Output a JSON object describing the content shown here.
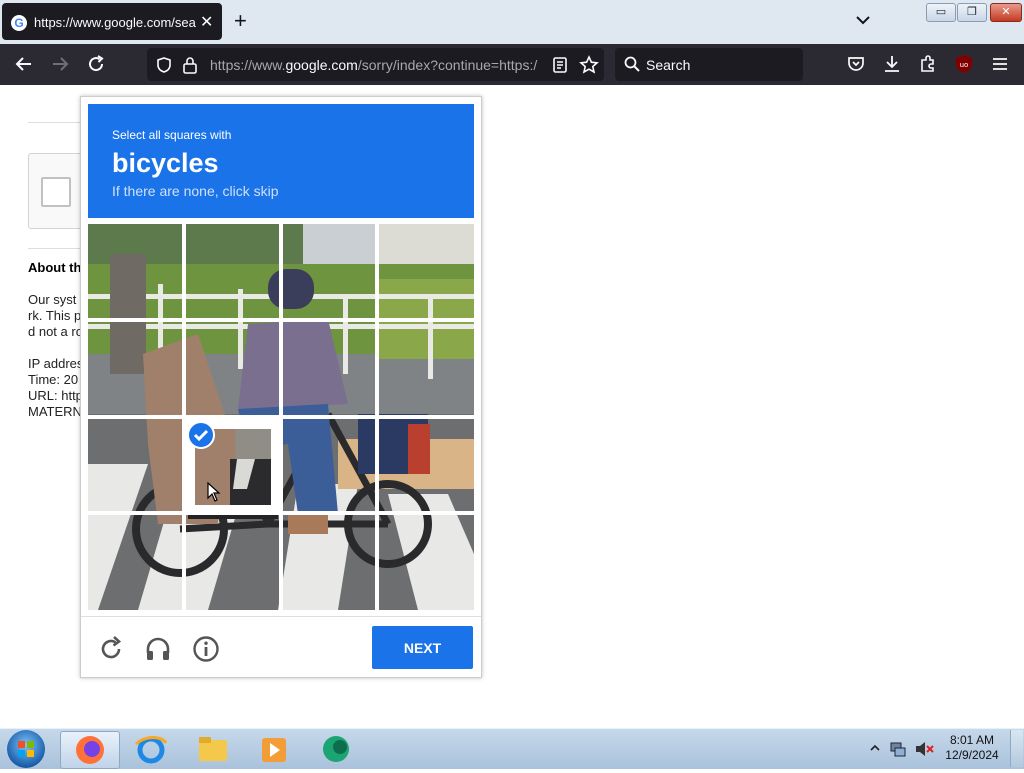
{
  "browser": {
    "tab": {
      "title": "https://www.google.com/search",
      "favicon_letter": "G"
    },
    "window_controls": {
      "minimize": "▭",
      "maximize": "❐",
      "close": "✕"
    },
    "url": {
      "prefix": "https://www.",
      "domain": "google.com",
      "path": "/sorry/index?continue=https:/"
    },
    "search": {
      "placeholder": "Search"
    }
  },
  "page": {
    "about_heading": "About th",
    "lines": [
      "Our syst",
      "rk. This p",
      "d not a ro",
      "",
      "IP addres",
      "Time: 20",
      "URL: http",
      "MATERN"
    ]
  },
  "captcha": {
    "instruction": "Select all squares with",
    "object": "bicycles",
    "subtext": "If there are none, click skip",
    "next_label": "NEXT",
    "selected_tiles": [
      {
        "row": 3,
        "col": 2
      }
    ]
  },
  "taskbar": {
    "time": "8:01 AM",
    "date": "12/9/2024"
  },
  "colors": {
    "accent": "#1a73e8",
    "tab_dark": "#1c1b22",
    "toolbar": "#2b2a33"
  }
}
